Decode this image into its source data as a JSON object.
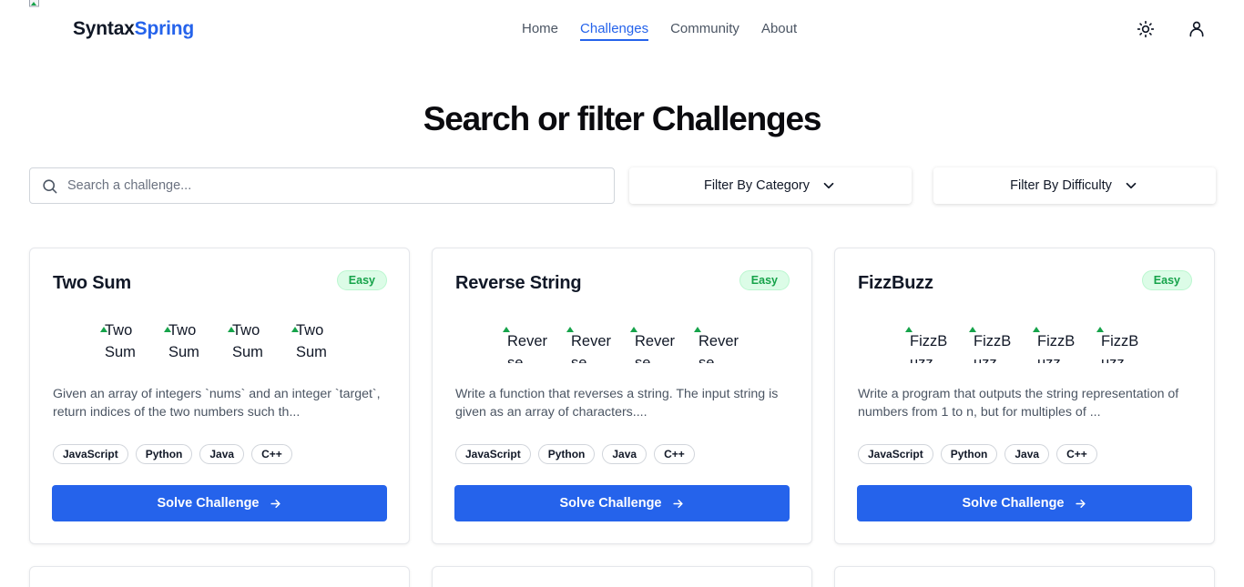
{
  "header": {
    "brand_part1": "Syntax",
    "brand_part2": "Spring",
    "nav": [
      {
        "label": "Home"
      },
      {
        "label": "Challenges"
      },
      {
        "label": "Community"
      },
      {
        "label": "About"
      }
    ],
    "active_nav": "Challenges",
    "icons": [
      "sun-icon",
      "user-icon"
    ]
  },
  "main": {
    "title": "Search or filter Challenges",
    "search": {
      "placeholder": "Search a challenge...",
      "value": ""
    },
    "filters": [
      {
        "label": "Filter By Category"
      },
      {
        "label": "Filter By Difficulty"
      }
    ]
  },
  "cards": [
    {
      "title": "Two Sum",
      "difficulty": "Easy",
      "image_alts": [
        "Two Sum",
        "Two Sum",
        "Two Sum",
        "Two Sum"
      ],
      "description": "Given an array of integers `nums` and an integer `target`, return indices of the two numbers such th...",
      "languages": [
        "JavaScript",
        "Python",
        "Java",
        "C++"
      ],
      "button_label": "Solve Challenge"
    },
    {
      "title": "Reverse String",
      "difficulty": "Easy",
      "image_alts": [
        "Reverse String",
        "Reverse String",
        "Reverse String",
        "Reverse String"
      ],
      "description": "Write a function that reverses a string. The input string is given as an array of characters....",
      "languages": [
        "JavaScript",
        "Python",
        "Java",
        "C++"
      ],
      "button_label": "Solve Challenge"
    },
    {
      "title": "FizzBuzz",
      "difficulty": "Easy",
      "image_alts": [
        "FizzBuzz",
        "FizzBuzz",
        "FizzBuzz",
        "FizzBuzz"
      ],
      "description": "Write a program that outputs the string representation of numbers from 1 to n, but for multiples of ...",
      "languages": [
        "JavaScript",
        "Python",
        "Java",
        "C++"
      ],
      "button_label": "Solve Challenge"
    }
  ],
  "colors": {
    "accent": "#2563eb",
    "easy_badge_bg": "#dcfce7",
    "easy_badge_text": "#16a34a"
  }
}
